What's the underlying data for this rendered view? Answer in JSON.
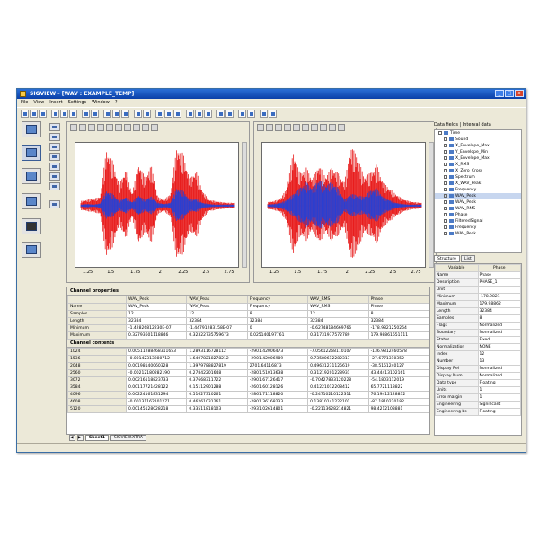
{
  "window": {
    "title": "SIGVIEW - [WAV : EXAMPLE_TEMP]",
    "menu": [
      "File",
      "View",
      "Insert",
      "Settings",
      "Window",
      "?"
    ]
  },
  "plots": [
    {
      "x_ticks": [
        "1.25",
        "1.5",
        "1.75",
        "2",
        "2.25",
        "2.5",
        "2.75"
      ]
    },
    {
      "x_ticks": [
        "1.25",
        "1.5",
        "1.75",
        "2",
        "2.25",
        "2.5",
        "2.75"
      ]
    }
  ],
  "chart_data": [
    {
      "type": "line",
      "series": [
        {
          "name": "",
          "color": "#e81d1d",
          "envelope": [
            0.08,
            0.1,
            0.12,
            0.15,
            0.95,
            0.75,
            0.35,
            0.62,
            0.2,
            0.72,
            0.48,
            0.68,
            0.15,
            0.1,
            0.2,
            1.0,
            0.88,
            0.45,
            0.6,
            0.25,
            0.1,
            0.08,
            0.06,
            0.05,
            0.05
          ]
        },
        {
          "name": "",
          "color": "#2a3fd1",
          "envelope": [
            0.02,
            0.03,
            0.02,
            0.04,
            0.25,
            0.2,
            0.08,
            0.15,
            0.06,
            0.18,
            0.1,
            0.16,
            0.05,
            0.03,
            0.05,
            0.3,
            0.25,
            0.1,
            0.12,
            0.05,
            0.03,
            0.02,
            0.02,
            0.02,
            0.02
          ]
        }
      ],
      "x_ticks": [
        "1.25",
        "1.5",
        "1.75",
        "2",
        "2.25",
        "2.5",
        "2.75"
      ]
    },
    {
      "type": "line",
      "series": [
        {
          "name": "",
          "color": "#e81d1d",
          "envelope": [
            0.06,
            0.08,
            0.12,
            0.3,
            0.92,
            0.55,
            0.65,
            0.45,
            0.7,
            0.5,
            0.65,
            0.55,
            0.4,
            1.0,
            0.85,
            0.5,
            0.55,
            0.7,
            0.4,
            0.3,
            0.2,
            0.12,
            0.08,
            0.06,
            0.05
          ]
        },
        {
          "name": "",
          "color": "#2a3fd1",
          "envelope": [
            0.02,
            0.03,
            0.05,
            0.1,
            0.2,
            0.3,
            0.4,
            0.3,
            0.45,
            0.35,
            0.4,
            0.3,
            0.1,
            0.2,
            0.18,
            0.15,
            0.25,
            0.3,
            0.15,
            0.1,
            0.05,
            0.03,
            0.02,
            0.02,
            0.02
          ]
        }
      ],
      "x_ticks": [
        "1.25",
        "1.5",
        "1.75",
        "2",
        "2.25",
        "2.5",
        "2.75"
      ]
    }
  ],
  "properties_table": {
    "title": "Channel properties",
    "headers": [
      "",
      "WAV_Peak",
      "WAV_Peak",
      "Frequency",
      "WAV_RMS",
      "Phase"
    ],
    "rows": [
      [
        "Name",
        "WAV_Peak",
        "WAV_Peak",
        "Frequency",
        "WAV_RMS",
        "Phase"
      ],
      [
        "Samples",
        "12",
        "12",
        "8",
        "12",
        "8"
      ],
      [
        "Length",
        "32384",
        "32384",
        "32384",
        "32384",
        "32384"
      ],
      [
        "Minimum",
        "-1.42826812230E-07",
        "-1.44791283158E-07",
        "0",
        "-0.62748184669766",
        "-178.9821250264"
      ],
      [
        "Maximum",
        "0.32793601118846",
        "0.32322735759673",
        "0.025140197761",
        "0.31731977572789",
        "179.98861651111"
      ]
    ]
  },
  "contents_table": {
    "title": "Channel contents",
    "rows": [
      [
        "1024",
        "0.00511288468311653",
        "1.2893116728112",
        "-2901.42006473",
        "-7.05612268110107",
        "-136.9812460578"
      ],
      [
        "1536",
        "-0.00142313280712",
        "1.64078218278212",
        "-2901.42006989",
        "0.73580612282317",
        "-27.6771310352"
      ],
      [
        "2048",
        "0.00198140060328",
        "1.3979788827819",
        "2701.64116873",
        "0.49631231125619",
        "-38.5151240127"
      ],
      [
        "2560",
        "-0.00212180282190",
        "0.27842201648",
        "-2801.51013638",
        "0.31219201228931",
        "43.44413102161"
      ],
      [
        "3072",
        "0.00216118823733",
        "0.37668311722",
        "-2901.67126417",
        "-0.70427833120228",
        "-54.1803112019"
      ],
      [
        "3584",
        "0.00117721428122",
        "0.15112901288",
        "-2601.60128126",
        "0.41221012208412",
        "65.7721118822"
      ],
      [
        "4096",
        "0.00224161831294",
        "0.51627310261",
        "-2861.71118820",
        "-0.24710210122311",
        "76.19412128832"
      ],
      [
        "4608",
        "-0.00131162101271",
        "0.46261031261",
        "-2801.36168233",
        "0.13810141222101",
        "-87.1810220182"
      ],
      [
        "5120",
        "0.00145128028218",
        "0.33511818103",
        "-2931.02614801",
        "-0.22113628214821",
        "98.4212108881"
      ]
    ]
  },
  "sheet_tabs": [
    "Sheet1",
    "SIGVIEW.XTRA"
  ],
  "right_panel": {
    "header": "Data fields | Interval data",
    "tree": [
      "Time",
      "Sound",
      "X_Envelope_Max",
      "Y_Envelope_Min",
      "X_Envelope_Max",
      "X_RMS",
      "X_Zero_Cross",
      "Spectrum",
      "X_WAV_Peak",
      "Frequency",
      "WAV_Peak",
      "WAV_Peak",
      "WAV_RMS",
      "Phase",
      "FilteredSignal",
      "Frequency",
      "WAV_Peak"
    ],
    "selected_index": 10,
    "tabs": [
      "Structure",
      "List"
    ],
    "props_header": [
      "Variable",
      "Phase"
    ],
    "props": [
      [
        "Name",
        "Phase"
      ],
      [
        "Description",
        "PHASE_1"
      ],
      [
        "Unit",
        ""
      ],
      [
        "Minimum",
        "-178.9821"
      ],
      [
        "Maximum",
        "179.98862"
      ],
      [
        "Length",
        "32384"
      ],
      [
        "Samples",
        "8"
      ],
      [
        "Flags",
        "Normalized"
      ],
      [
        "Boundary",
        "Normalized"
      ],
      [
        "Status",
        "Fixed"
      ],
      [
        "Normalization",
        "NONE"
      ],
      [
        "Index",
        "12"
      ],
      [
        "Number",
        "13"
      ],
      [
        "Display Rel",
        "Normalized"
      ],
      [
        "Display Num",
        "Normalized"
      ],
      [
        "Data type",
        "Floating"
      ],
      [
        "Units",
        "1"
      ],
      [
        "Error margin",
        "1"
      ],
      [
        "Engineering",
        "Significant"
      ],
      [
        "Engineering bs",
        "Floating"
      ]
    ]
  }
}
